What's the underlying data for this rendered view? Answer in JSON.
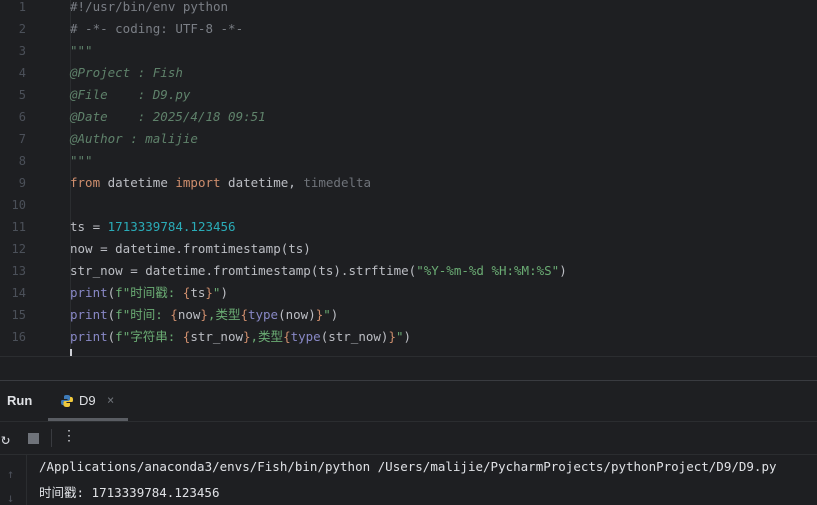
{
  "editor": {
    "lines": [
      {
        "n": "1",
        "tokens": [
          [
            "#!/usr/bin/env python",
            "cm"
          ]
        ]
      },
      {
        "n": "2",
        "tokens": [
          [
            "# -*- coding: UTF-8 -*-",
            "cm"
          ]
        ]
      },
      {
        "n": "3",
        "tokens": [
          [
            "\"\"\"",
            "doc"
          ]
        ]
      },
      {
        "n": "4",
        "tokens": [
          [
            "@Project : Fish",
            "doc"
          ]
        ]
      },
      {
        "n": "5",
        "tokens": [
          [
            "@File    : D9.py",
            "doc"
          ]
        ]
      },
      {
        "n": "6",
        "tokens": [
          [
            "@Date    : 2025/4/18 09:51",
            "doc"
          ]
        ]
      },
      {
        "n": "7",
        "tokens": [
          [
            "@Author : malijie",
            "doc"
          ]
        ]
      },
      {
        "n": "8",
        "tokens": [
          [
            "\"\"\"",
            "doc"
          ]
        ]
      },
      {
        "n": "9",
        "tokens": [
          [
            "from",
            "kw"
          ],
          [
            " datetime ",
            "id"
          ],
          [
            "import",
            "kw"
          ],
          [
            " datetime, ",
            "id"
          ],
          [
            "timedelta",
            "un"
          ]
        ]
      },
      {
        "n": "10",
        "tokens": []
      },
      {
        "n": "11",
        "tokens": [
          [
            "ts = ",
            "id"
          ],
          [
            "1713339784.123456",
            "num"
          ]
        ]
      },
      {
        "n": "12",
        "tokens": [
          [
            "now = datetime.fromtimestamp(ts)",
            "id"
          ]
        ]
      },
      {
        "n": "13",
        "tokens": [
          [
            "str_now = datetime.fromtimestamp(ts).strftime(",
            "id"
          ],
          [
            "\"%Y-%m-%d %H:%M:%S\"",
            "str"
          ],
          [
            ")",
            "id"
          ]
        ]
      },
      {
        "n": "14",
        "tokens": [
          [
            "print",
            "bi"
          ],
          [
            "(",
            "id"
          ],
          [
            "f\"时间戳: ",
            "str"
          ],
          [
            "{",
            "br"
          ],
          [
            "ts",
            "id"
          ],
          [
            "}",
            "br"
          ],
          [
            "\"",
            "str"
          ],
          [
            ")",
            "id"
          ]
        ]
      },
      {
        "n": "15",
        "tokens": [
          [
            "print",
            "bi"
          ],
          [
            "(",
            "id"
          ],
          [
            "f\"时间: ",
            "str"
          ],
          [
            "{",
            "br"
          ],
          [
            "now",
            "id"
          ],
          [
            "}",
            "br"
          ],
          [
            ",类型",
            "str"
          ],
          [
            "{",
            "br"
          ],
          [
            "type",
            "bi"
          ],
          [
            "(now)",
            "id"
          ],
          [
            "}",
            "br"
          ],
          [
            "\"",
            "str"
          ],
          [
            ")",
            "id"
          ]
        ]
      },
      {
        "n": "16",
        "tokens": [
          [
            "print",
            "bi"
          ],
          [
            "(",
            "id"
          ],
          [
            "f\"字符串: ",
            "str"
          ],
          [
            "{",
            "br"
          ],
          [
            "str_now",
            "id"
          ],
          [
            "}",
            "br"
          ],
          [
            ",类型",
            "str"
          ],
          [
            "{",
            "br"
          ],
          [
            "type",
            "bi"
          ],
          [
            "(str_now)",
            "id"
          ],
          [
            "}",
            "br"
          ],
          [
            "\"",
            "str"
          ],
          [
            ")",
            "id"
          ]
        ]
      }
    ]
  },
  "run_panel": {
    "title": "Run",
    "tab_name": "D9",
    "tab_close": "×",
    "more": "⋮",
    "rerun": "↻",
    "console": [
      "/Applications/anaconda3/envs/Fish/bin/python /Users/malijie/PycharmProjects/pythonProject/D9/D9.py",
      "时间戳: 1713339784.123456"
    ],
    "scroll_up": "↑",
    "scroll_down": "↓"
  }
}
